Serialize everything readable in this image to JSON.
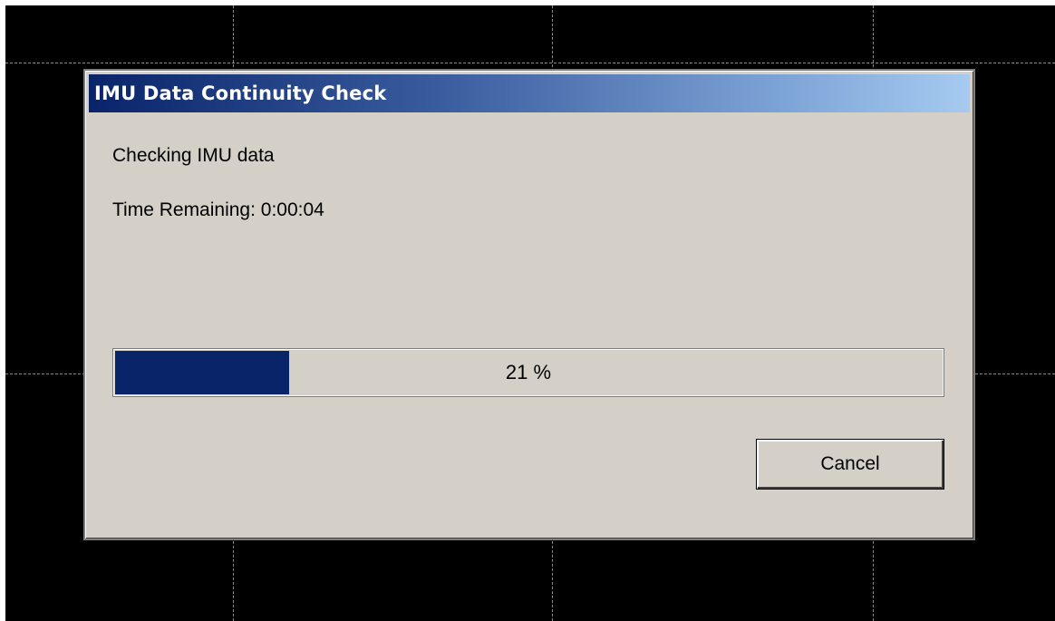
{
  "dialog": {
    "title": "IMU Data Continuity Check",
    "status_message": "Checking IMU data",
    "time_remaining": "Time Remaining: 0:00:04",
    "progress": {
      "percent": 21,
      "label": "21 %",
      "fill_color": "#0a246a"
    },
    "cancel_label": "Cancel"
  },
  "colors": {
    "background": "#000000",
    "dialog_face": "#d4d0c8",
    "titlebar_start": "#0a246a",
    "titlebar_end": "#a6caf0"
  }
}
